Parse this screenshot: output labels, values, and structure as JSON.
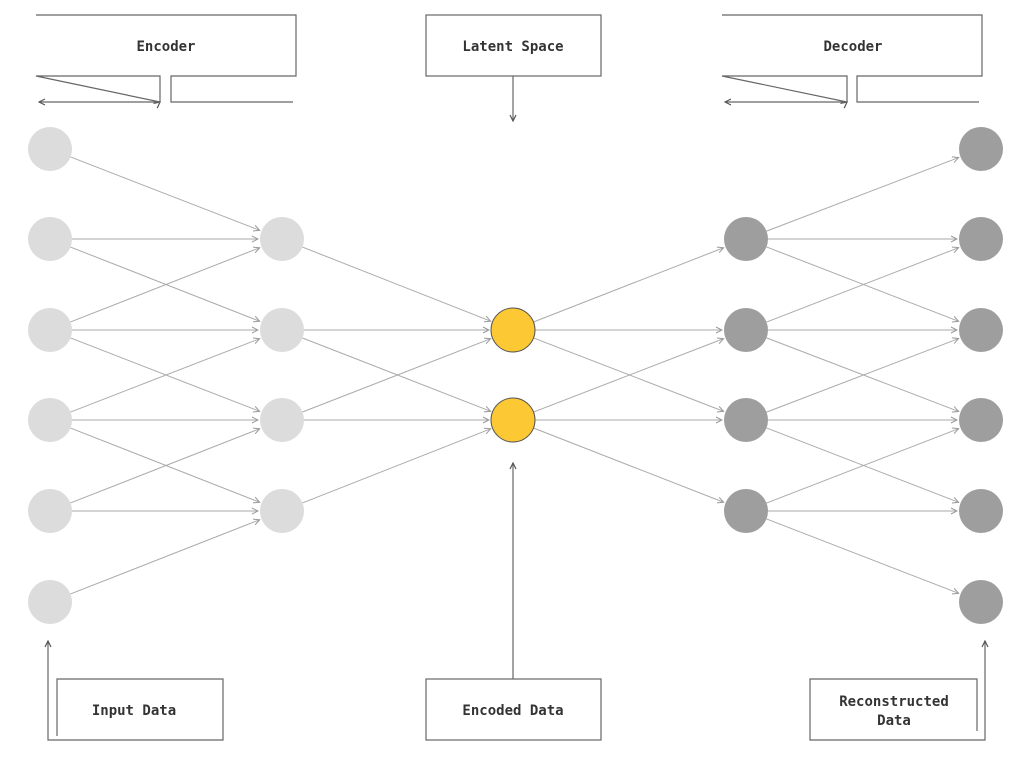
{
  "labels": {
    "encoder": "Encoder",
    "latent_space": "Latent Space",
    "decoder": "Decoder",
    "input_data": "Input Data",
    "encoded_data": "Encoded Data",
    "reconstructed_data_line1": "Reconstructed",
    "reconstructed_data_line2": "Data"
  },
  "network": {
    "layers": [
      {
        "name": "input",
        "nodes": 6,
        "color": "#dcdcdc"
      },
      {
        "name": "encoder-hidden",
        "nodes": 4,
        "color": "#dcdcdc"
      },
      {
        "name": "latent",
        "nodes": 2,
        "color": "#fcc934",
        "outline": "#555555"
      },
      {
        "name": "decoder-hidden",
        "nodes": 4,
        "color": "#9e9e9e"
      },
      {
        "name": "output",
        "nodes": 6,
        "color": "#9e9e9e"
      }
    ],
    "connection_color": "#aaaaaa"
  }
}
